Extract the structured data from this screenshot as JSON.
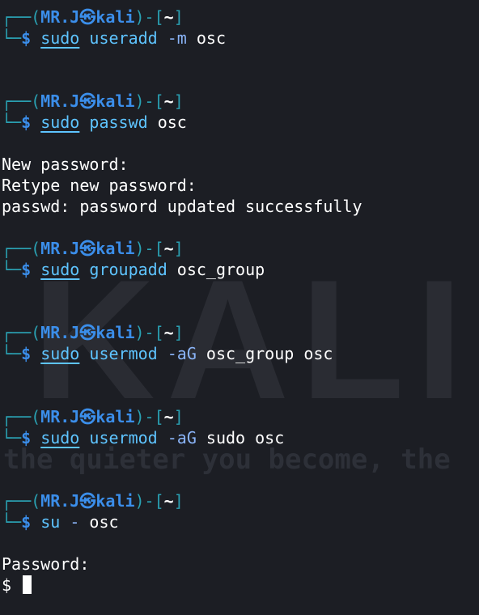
{
  "prompt": {
    "corner_top": "┌──",
    "corner_bottom": "└─",
    "open": "(",
    "user": "MR.J",
    "at_symbol": "㉿",
    "host": "kali",
    "close": ")-[",
    "cwd": "~",
    "end": "]",
    "dollar": "$"
  },
  "blocks": [
    {
      "command": "sudo",
      "subcommand": "useradd",
      "option": "-m",
      "arg": "osc",
      "output": []
    },
    {
      "command": "sudo",
      "subcommand": "passwd",
      "option": "",
      "arg": "osc",
      "output": [
        "New password:",
        "Retype new password:",
        "passwd: password updated successfully"
      ]
    },
    {
      "command": "sudo",
      "subcommand": "groupadd",
      "option": "",
      "arg": "osc_group",
      "output": []
    },
    {
      "command": "sudo",
      "subcommand": "usermod",
      "option": "-aG",
      "arg": "osc_group osc",
      "output": []
    },
    {
      "command": "sudo",
      "subcommand": "usermod",
      "option": "-aG",
      "arg": "sudo osc",
      "output": []
    },
    {
      "command": "su",
      "subcommand": "-",
      "option": "",
      "arg": "osc",
      "output": []
    }
  ],
  "tail": {
    "password_prompt": "Password:",
    "shell_prompt": "$"
  },
  "wallpaper": {
    "tagline": "the quieter you become, the"
  },
  "colors": {
    "background": "#1c1e24",
    "prompt_frame": "#2aa1b3",
    "prompt_user": "#3b8eea",
    "command": "#5ec4ff",
    "text": "#ffffff"
  }
}
